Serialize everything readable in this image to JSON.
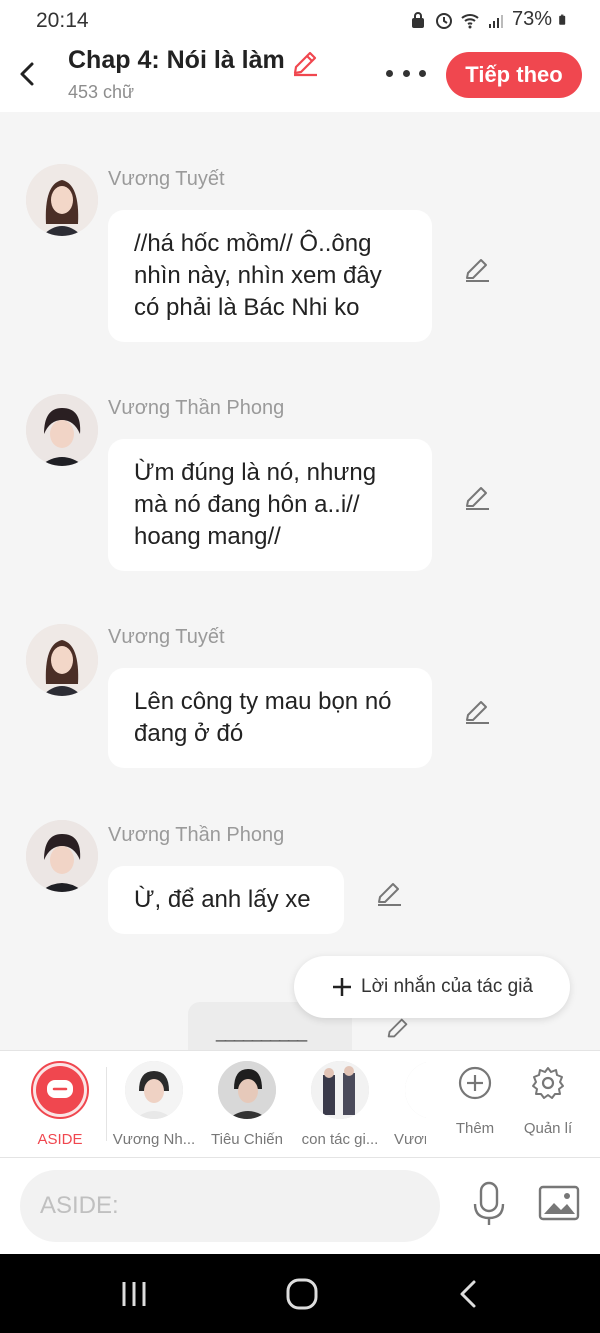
{
  "status_bar": {
    "time": "20:14",
    "battery": "73%"
  },
  "header": {
    "title": "Chap 4: Nói là làm",
    "word_count": "453 chữ",
    "next_label": "Tiếp theo"
  },
  "messages": [
    {
      "sender": "Vương Tuyết",
      "text": "//há hốc mồm// Ô..ông nhìn này, nhìn xem đây có phải là Bác Nhi ko"
    },
    {
      "sender": "Vương Thần Phong",
      "text": "Ừm đúng là nó, nhưng mà nó đang hôn a..i// hoang mang//"
    },
    {
      "sender": "Vương Tuyết",
      "text": "Lên công ty mau bọn nó đang ở đó"
    },
    {
      "sender": "Vương Thần Phong",
      "text": "Ừ, để anh lấy xe"
    }
  ],
  "draft": {
    "text": "__________"
  },
  "author_note_label": "Lời nhắn của tác giả",
  "characters": {
    "items": [
      {
        "label": "ASIDE"
      },
      {
        "label": "Vương Nh..."
      },
      {
        "label": "Tiêu Chiến"
      },
      {
        "label": "con tác gi..."
      },
      {
        "label": "Vươn"
      }
    ],
    "add_label": "Thêm",
    "manage_label": "Quản lí"
  },
  "input": {
    "placeholder": "ASIDE:"
  },
  "colors": {
    "accent": "#f0474f",
    "background": "#f5f5f5",
    "bubble": "#ffffff"
  }
}
